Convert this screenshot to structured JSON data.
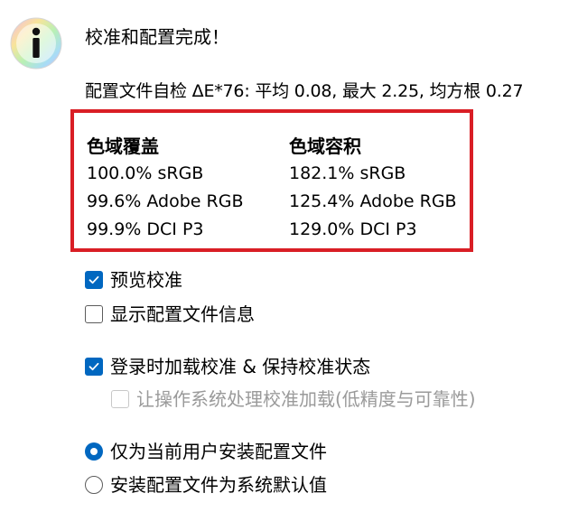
{
  "message": {
    "title": "校准和配置完成！",
    "profile_check": "配置文件自检 ΔE*76: 平均 0.08, 最大 2.25, 均方根 0.27"
  },
  "gamut": {
    "coverage": {
      "header": "色域覆盖",
      "values": [
        "100.0% sRGB",
        "99.6% Adobe RGB",
        "99.9% DCI P3"
      ]
    },
    "volume": {
      "header": "色域容积",
      "values": [
        "182.1% sRGB",
        "125.4% Adobe RGB",
        "129.0% DCI P3"
      ]
    }
  },
  "options": {
    "preview_calibration": {
      "label": "预览校准",
      "checked": true
    },
    "show_profile_info": {
      "label": "显示配置文件信息",
      "checked": false
    },
    "load_on_login": {
      "label": "登录时加载校准 & 保持校准状态",
      "checked": true
    },
    "let_os_handle": {
      "label": "让操作系统处理校准加载(低精度与可靠性)",
      "checked": false,
      "disabled": true
    }
  },
  "install": {
    "current_user": {
      "label": "仅为当前用户安装配置文件",
      "selected": true
    },
    "system_default": {
      "label": "安装配置文件为系统默认值",
      "selected": false
    }
  },
  "colors": {
    "accent": "#0067c0",
    "highlight_border": "#d91e25",
    "disabled": "#9a9a9a"
  },
  "icons": {
    "message": "info-icon"
  }
}
